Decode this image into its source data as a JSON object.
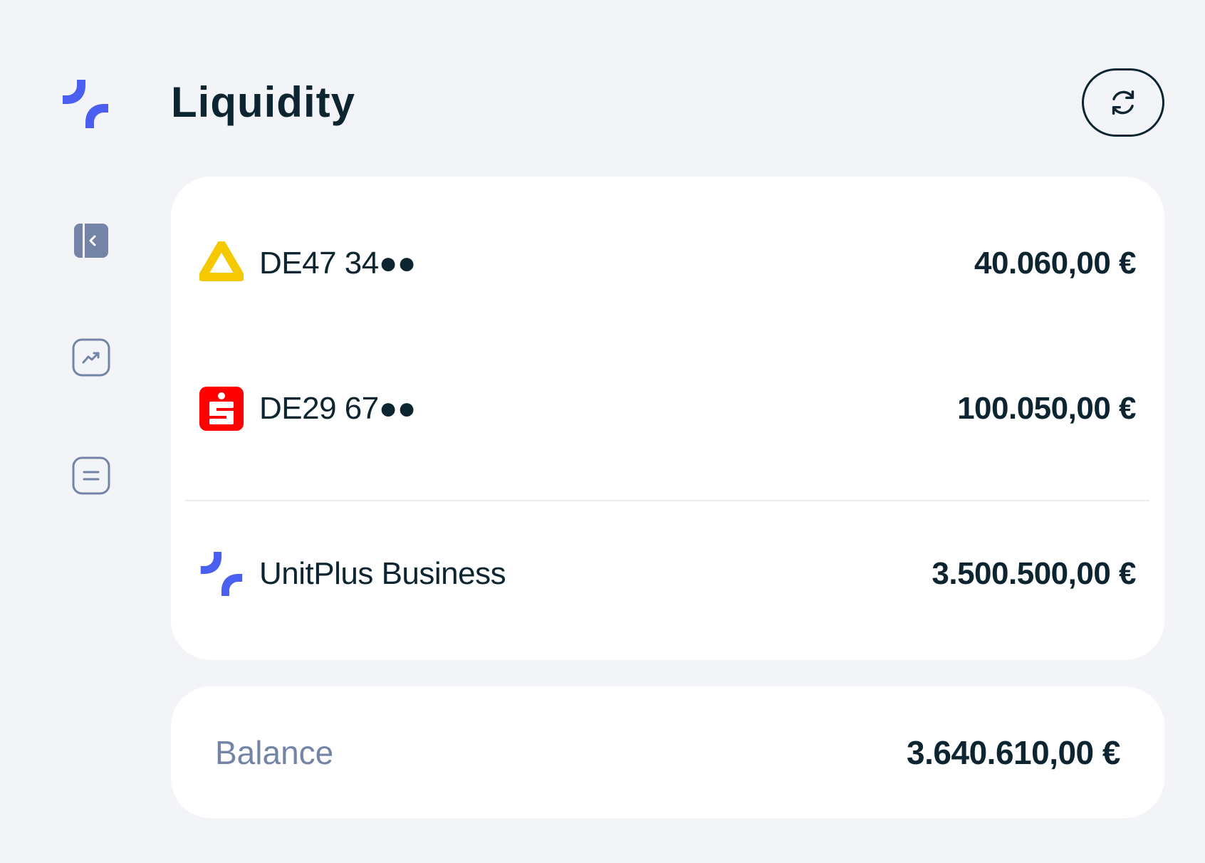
{
  "header": {
    "title": "Liquidity",
    "refresh_icon": "refresh-icon"
  },
  "brand": {
    "logo_icon": "unitplus-logo-icon",
    "accent_color": "#4a5ff0"
  },
  "nav": {
    "items": [
      {
        "icon": "sidebar-collapse-icon"
      },
      {
        "icon": "trending-up-icon"
      },
      {
        "icon": "list-icon"
      }
    ]
  },
  "accounts": [
    {
      "name": "DE47 34●●",
      "amount": "40.060,00 €",
      "bank_icon": "commerzbank-logo-icon",
      "bank_color": "#f5c800"
    },
    {
      "name": "DE29 67●●",
      "amount": "100.050,00 €",
      "bank_icon": "sparkasse-logo-icon",
      "bank_color": "#ff0000"
    },
    {
      "name": "UnitPlus Business",
      "amount": "3.500.500,00 €",
      "bank_icon": "unitplus-logo-icon",
      "bank_color": "#4a5ff0"
    }
  ],
  "balance": {
    "label": "Balance",
    "amount": "3.640.610,00 €"
  }
}
